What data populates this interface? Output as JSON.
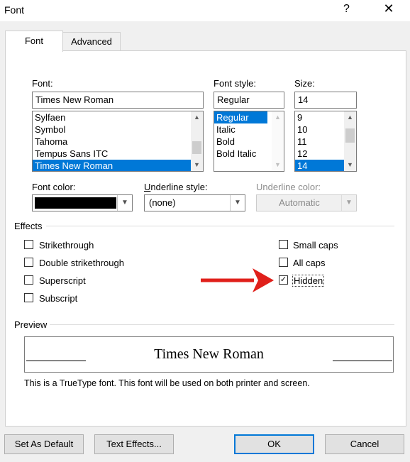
{
  "window": {
    "title": "Font",
    "help": "?",
    "close": "✕"
  },
  "tabs": [
    {
      "label": "Font"
    },
    {
      "label": "Advanced"
    }
  ],
  "font": {
    "label": "Font:",
    "value": "Times New Roman",
    "items": [
      "Sylfaen",
      "Symbol",
      "Tahoma",
      "Tempus Sans ITC",
      "Times New Roman"
    ]
  },
  "style": {
    "label": "Font style:",
    "value": "Regular",
    "items": [
      "Regular",
      "Italic",
      "Bold",
      "Bold Italic"
    ]
  },
  "size": {
    "label": "Size:",
    "value": "14",
    "items": [
      "9",
      "10",
      "11",
      "12",
      "14"
    ]
  },
  "color": {
    "label": "Font color:",
    "swatch": "#000000"
  },
  "underline_style": {
    "label": "Underline style:",
    "value": "(none)"
  },
  "underline_color": {
    "label": "Underline color:",
    "value": "Automatic"
  },
  "effects": {
    "label": "Effects",
    "left": [
      {
        "label": "Strikethrough",
        "checked": false
      },
      {
        "label": "Double strikethrough",
        "checked": false
      },
      {
        "label": "Superscript",
        "checked": false
      },
      {
        "label": "Subscript",
        "checked": false
      }
    ],
    "right": [
      {
        "label": "Small caps",
        "checked": false
      },
      {
        "label": "All caps",
        "checked": false
      },
      {
        "label": "Hidden",
        "checked": true
      }
    ]
  },
  "preview": {
    "label": "Preview",
    "sample": "Times New Roman",
    "note": "This is a TrueType font. This font will be used on both printer and screen."
  },
  "buttons": {
    "set_default": "Set As Default",
    "text_effects": "Text Effects...",
    "ok": "OK",
    "cancel": "Cancel"
  },
  "colors": {
    "selection": "#0078d7",
    "arrow": "#e0201b"
  }
}
